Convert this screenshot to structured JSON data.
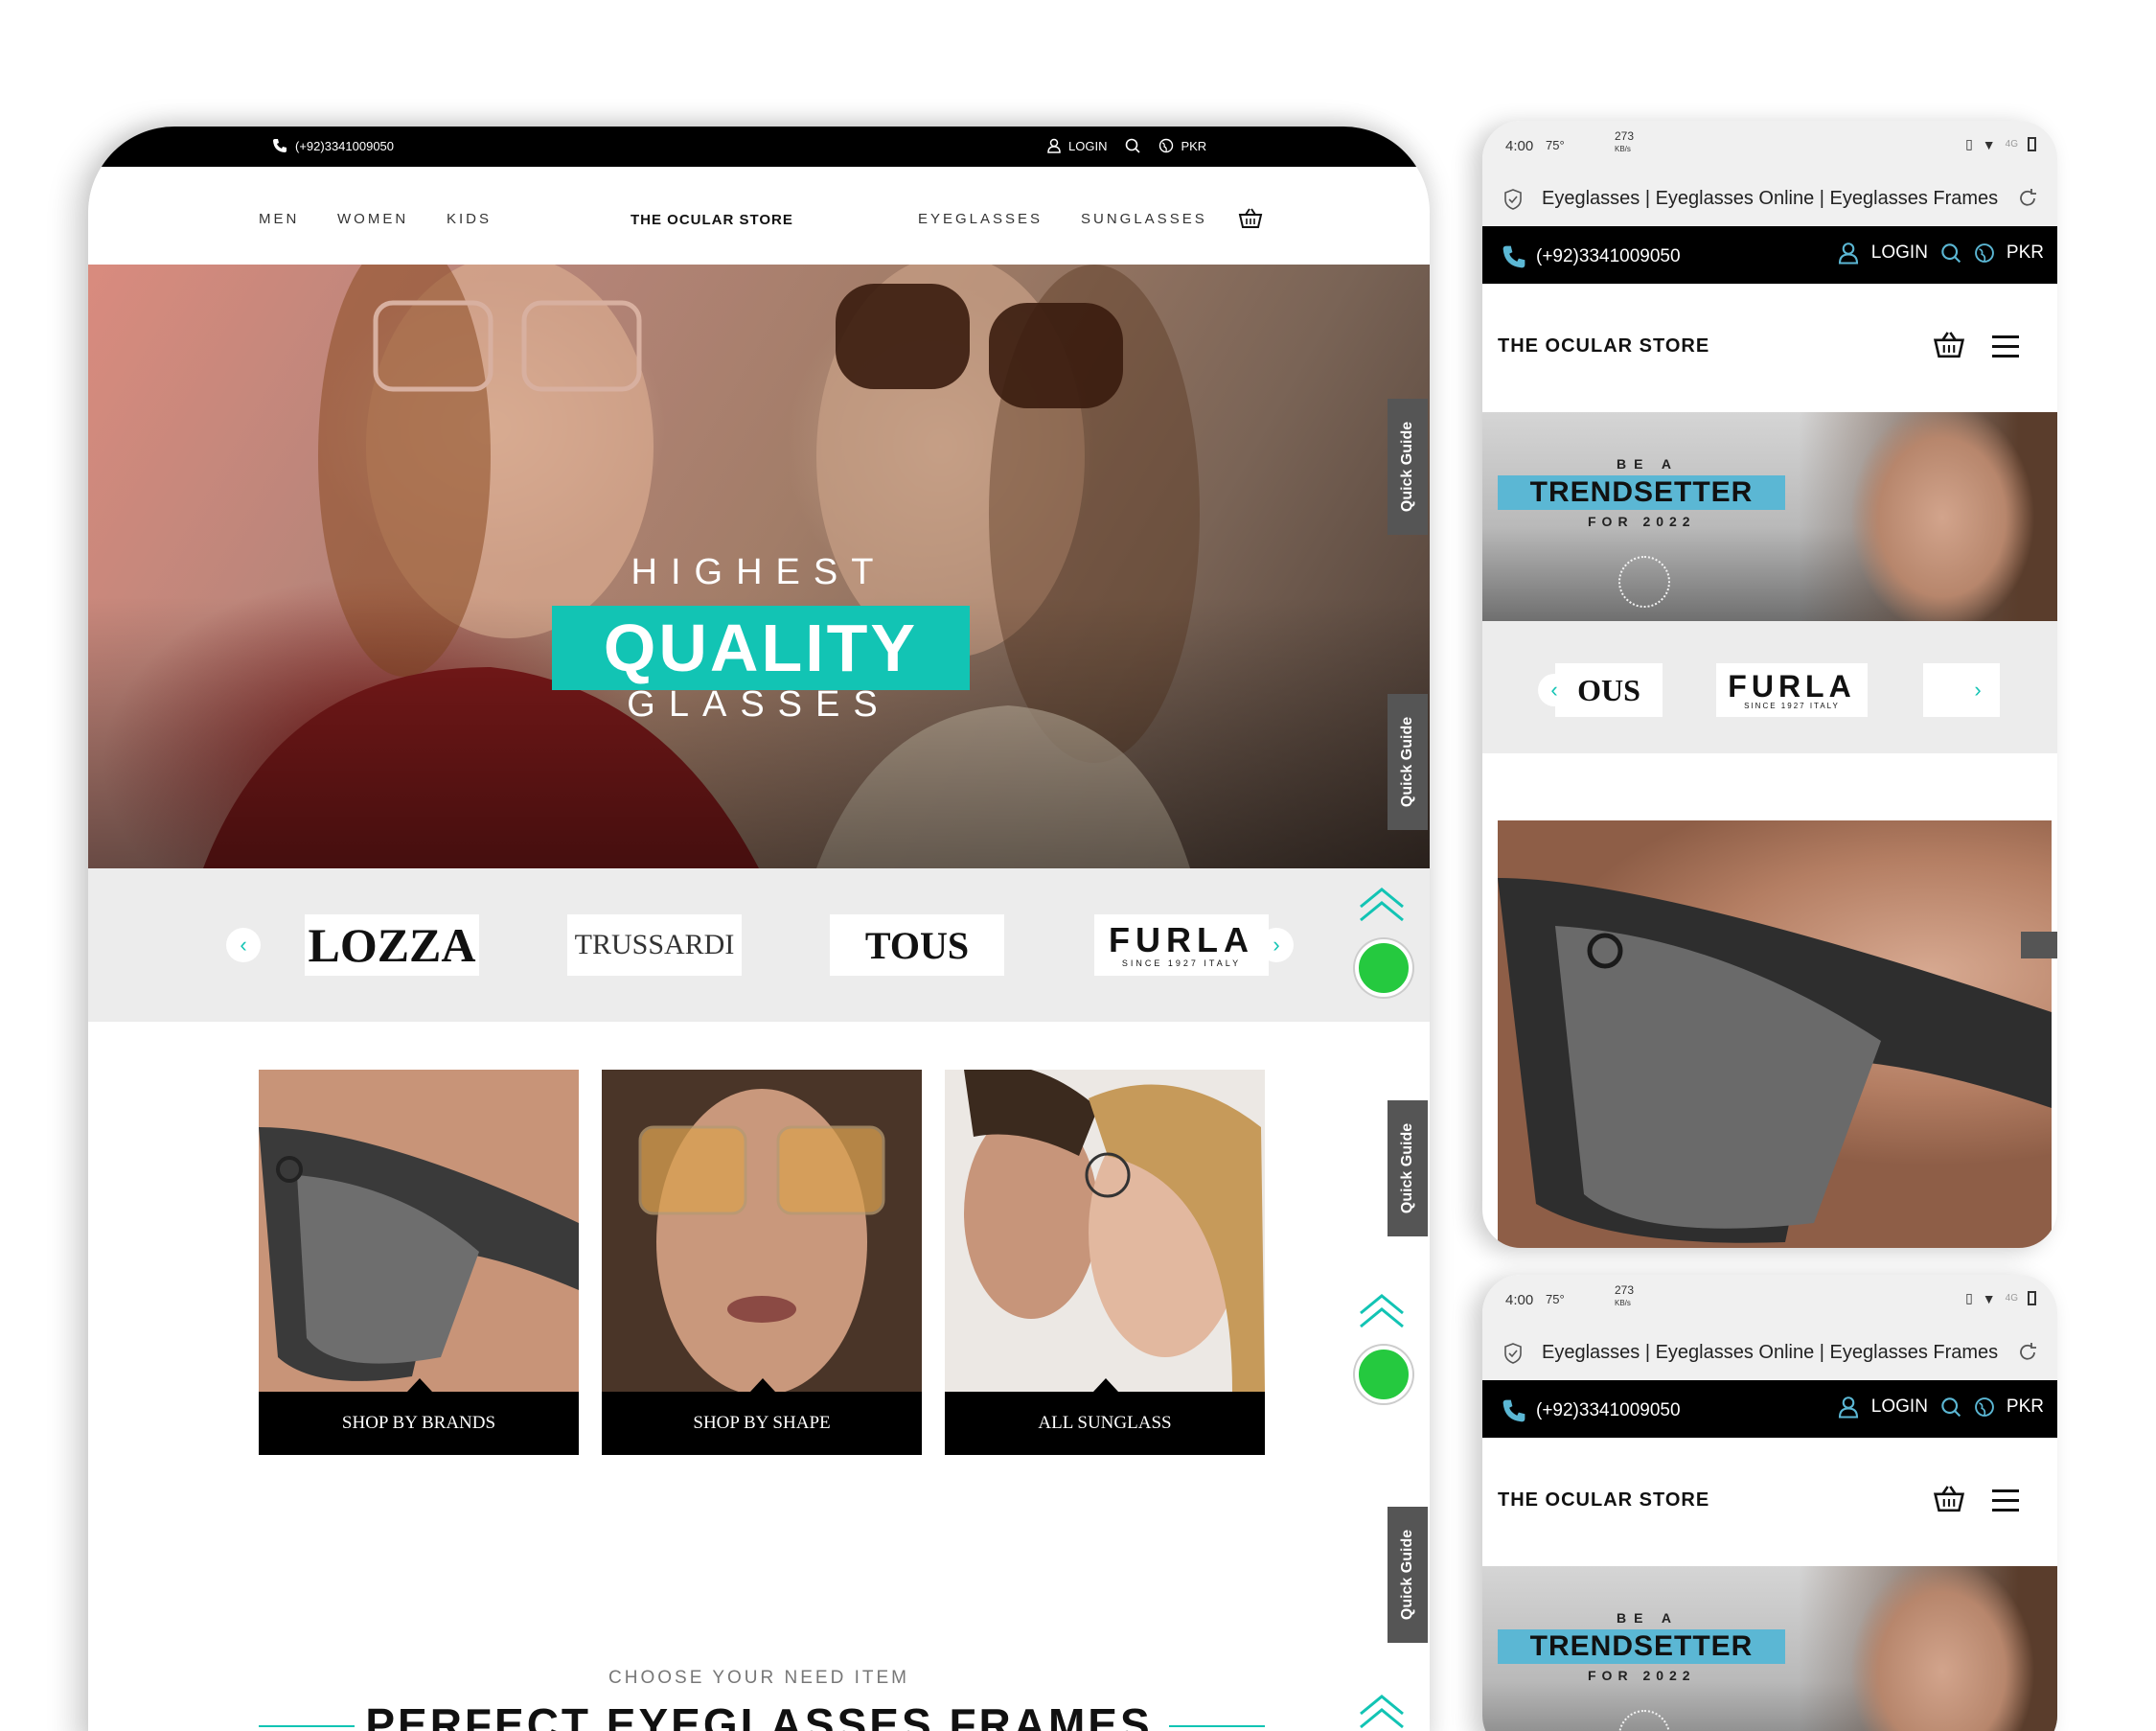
{
  "desktop": {
    "topbar": {
      "phone": "(+92)3341009050",
      "login": "LOGIN",
      "currency": "PKR"
    },
    "nav": {
      "left": [
        "MEN",
        "WOMEN",
        "KIDS"
      ],
      "logo": "THE OCULAR STORE",
      "right": [
        "EYEGLASSES",
        "SUNGLASSES"
      ]
    },
    "hero": {
      "line1": "HIGHEST",
      "line2": "QUALITY",
      "line3": "GLASSES"
    },
    "quick_guide": "Quick Guide",
    "brands": [
      "LOZZA",
      "TRUSSARDI",
      "TOUS",
      "FURLA"
    ],
    "furla_sub": "SINCE 1927 ITALY",
    "cards": [
      "SHOP BY BRANDS",
      "SHOP BY SHAPE",
      "ALL SUNGLASS"
    ],
    "section": {
      "kicker": "CHOOSE YOUR NEED ITEM",
      "title": "PERFECT EYEGLASSES FRAMES"
    }
  },
  "phone": {
    "status": {
      "time": "4:00",
      "temp": "75°",
      "speed": "273",
      "speed_unit": "KB/s",
      "net": "4G"
    },
    "url_title": "Eyeglasses | Eyeglasses Online | Eyeglasses Frames |",
    "topbar": {
      "phone": "(+92)3341009050",
      "login": "LOGIN",
      "currency": "PKR"
    },
    "logo": "THE OCULAR STORE",
    "banner": {
      "be_a": "BE A",
      "trend": "TRENDSETTER",
      "for": "FOR 2022"
    },
    "brands": [
      "OUS",
      "FURLA"
    ],
    "furla_sub": "SINCE 1927 ITALY"
  },
  "colors": {
    "accent": "#12c4b4",
    "banner_blue": "#5bb7d4",
    "black": "#000000",
    "whatsapp": "#25c93f"
  }
}
